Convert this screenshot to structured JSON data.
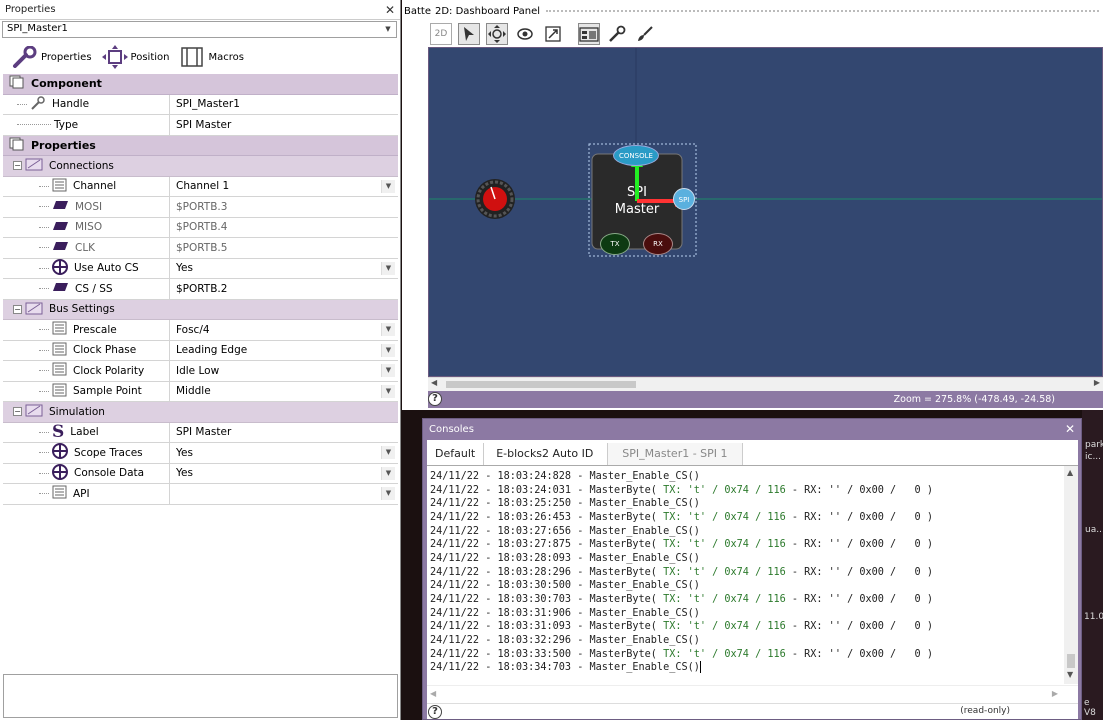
{
  "properties": {
    "panel_title": "Properties",
    "selected_component": "SPI_Master1",
    "tabs": [
      {
        "label": "Properties",
        "icon": "wrench-icon"
      },
      {
        "label": "Position",
        "icon": "move-icon"
      },
      {
        "label": "Macros",
        "icon": "macros-icon"
      }
    ],
    "sections": {
      "component": "Component",
      "properties": "Properties",
      "connections": "Connections",
      "bus_settings": "Bus Settings",
      "simulation": "Simulation"
    },
    "rows": {
      "handle": {
        "label": "Handle",
        "value": "SPI_Master1"
      },
      "type": {
        "label": "Type",
        "value": "SPI Master"
      },
      "channel": {
        "label": "Channel",
        "value": "Channel 1"
      },
      "mosi": {
        "label": "MOSI",
        "value": "$PORTB.3"
      },
      "miso": {
        "label": "MISO",
        "value": "$PORTB.4"
      },
      "clk": {
        "label": "CLK",
        "value": "$PORTB.5"
      },
      "use_auto_cs": {
        "label": "Use Auto CS",
        "value": "Yes"
      },
      "cs_ss": {
        "label": "CS / SS",
        "value": "$PORTB.2"
      },
      "prescale": {
        "label": "Prescale",
        "value": "Fosc/4"
      },
      "clock_phase": {
        "label": "Clock Phase",
        "value": "Leading Edge"
      },
      "clock_polarity": {
        "label": "Clock Polarity",
        "value": "Idle Low"
      },
      "sample_point": {
        "label": "Sample Point",
        "value": "Middle"
      },
      "label": {
        "label": "Label",
        "value": "SPI  Master"
      },
      "scope_traces": {
        "label": "Scope Traces",
        "value": "Yes"
      },
      "console_data": {
        "label": "Console Data",
        "value": "Yes"
      },
      "api": {
        "label": "API",
        "value": ""
      }
    }
  },
  "dashboard": {
    "clipped_tab": "Batte",
    "panel_title": "2D: Dashboard Panel",
    "toolbar_2d": "2D",
    "component": {
      "line1": "SPI",
      "line2": "Master",
      "console_label": "CONSOLE",
      "spi_label": "SPI",
      "tx_label": "TX",
      "rx_label": "RX"
    },
    "zoom_text": "Zoom = 275.8% (-478.49, -24.58)"
  },
  "consoles": {
    "panel_title": "Consoles",
    "tabs": [
      "Default",
      "E-blocks2 Auto ID",
      "SPI_Master1 - SPI 1"
    ],
    "status": "(read-only)",
    "log": [
      "24/11/22 - 18:03:24:828 - Master_Enable_CS()",
      "24/11/22 - 18:03:24:031 - MasterByte( TX: 't' / 0x74 / 116 - RX: '' / 0x00 /   0 )",
      "24/11/22 - 18:03:25:250 - Master_Enable_CS()",
      "24/11/22 - 18:03:26:453 - MasterByte( TX: 't' / 0x74 / 116 - RX: '' / 0x00 /   0 )",
      "24/11/22 - 18:03:27:656 - Master_Enable_CS()",
      "24/11/22 - 18:03:27:875 - MasterByte( TX: 't' / 0x74 / 116 - RX: '' / 0x00 /   0 )",
      "24/11/22 - 18:03:28:093 - Master_Enable_CS()",
      "24/11/22 - 18:03:28:296 - MasterByte( TX: 't' / 0x74 / 116 - RX: '' / 0x00 /   0 )",
      "24/11/22 - 18:03:30:500 - Master_Enable_CS()",
      "24/11/22 - 18:03:30:703 - MasterByte( TX: 't' / 0x74 / 116 - RX: '' / 0x00 /   0 )",
      "24/11/22 - 18:03:31:906 - Master_Enable_CS()",
      "24/11/22 - 18:03:31:093 - MasterByte( TX: 't' / 0x74 / 116 - RX: '' / 0x00 /   0 )",
      "24/11/22 - 18:03:32:296 - Master_Enable_CS()",
      "24/11/22 - 18:03:33:500 - MasterByte( TX: 't' / 0x74 / 116 - RX: '' / 0x00 /   0 )",
      "24/11/22 - 18:03:34:703 - Master_Enable_CS()"
    ]
  },
  "desktop": {
    "text1": "park",
    "text2": "ic...",
    "text3": "ua...",
    "text4": "11.0",
    "text5": "e V8"
  },
  "colors": {
    "accent": "#8c79a3",
    "section_bg": "#d5c5da",
    "canvas_bg": "#334770",
    "green_text": "#2c7a2c"
  }
}
